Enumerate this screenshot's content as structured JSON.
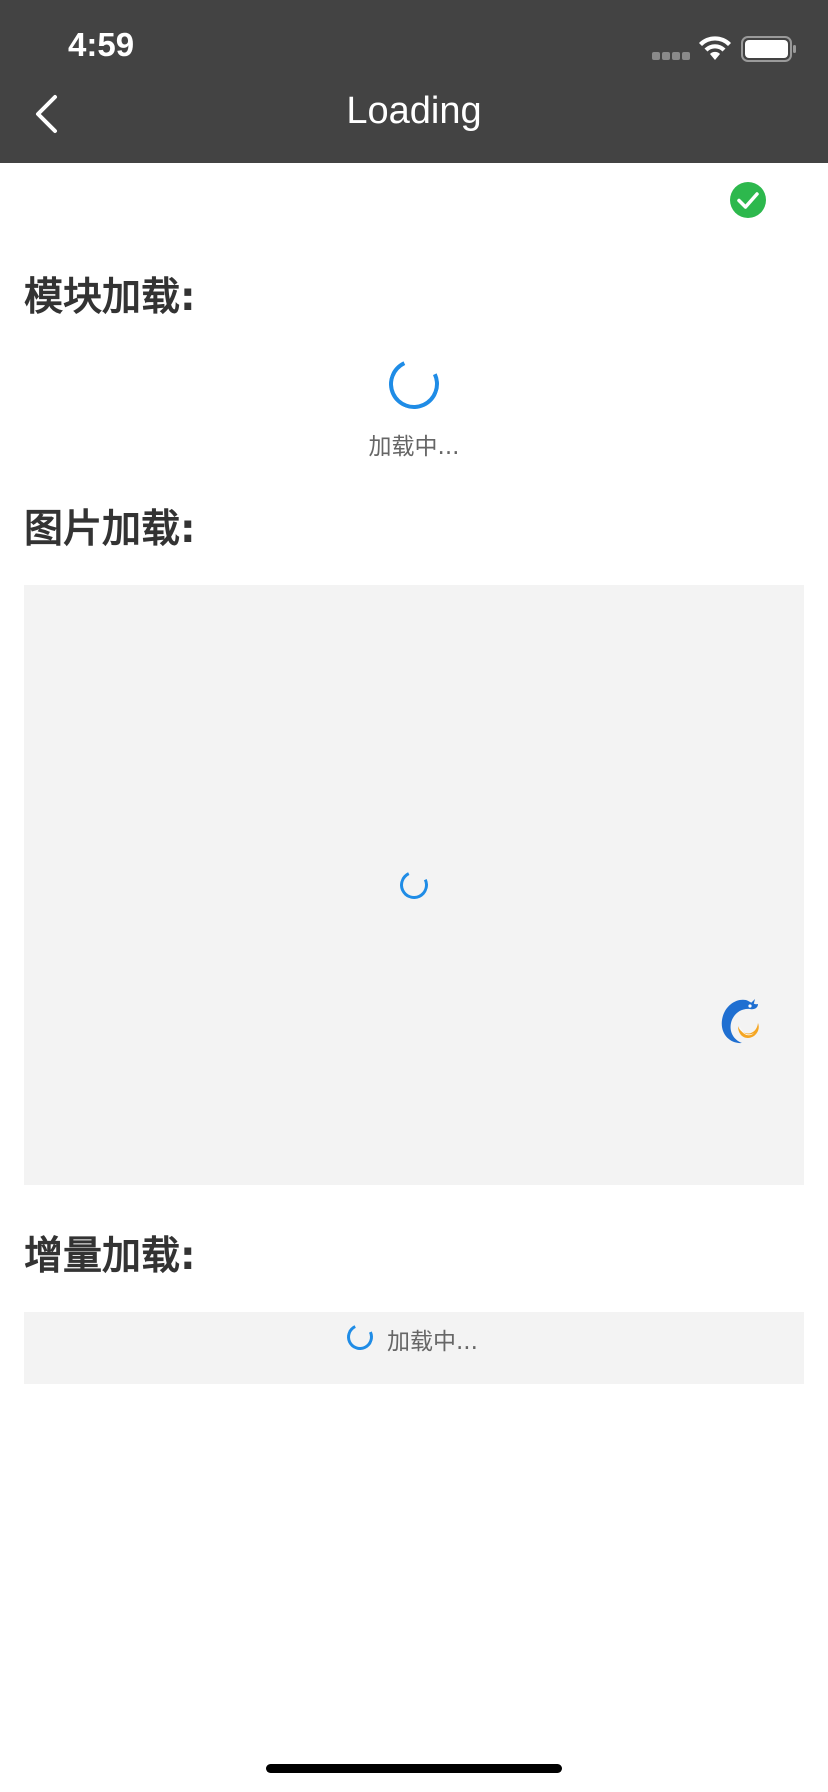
{
  "status_bar": {
    "time": "4:59"
  },
  "nav": {
    "title": "Loading",
    "back_icon": "chevron-left-icon"
  },
  "status_icon": "check-circle-icon",
  "sections": {
    "module_loading": {
      "heading": "模块加载:",
      "loading_text": "加载中..."
    },
    "image_loading": {
      "heading": "图片加载:",
      "logo_icon": "dolphin-logo-icon"
    },
    "incremental_loading": {
      "heading": "增量加载:",
      "loading_text": "加载中..."
    }
  },
  "colors": {
    "nav_background": "#434343",
    "accent": "#1f8ce6",
    "success": "#2db84d",
    "placeholder_background": "#f3f3f3"
  }
}
